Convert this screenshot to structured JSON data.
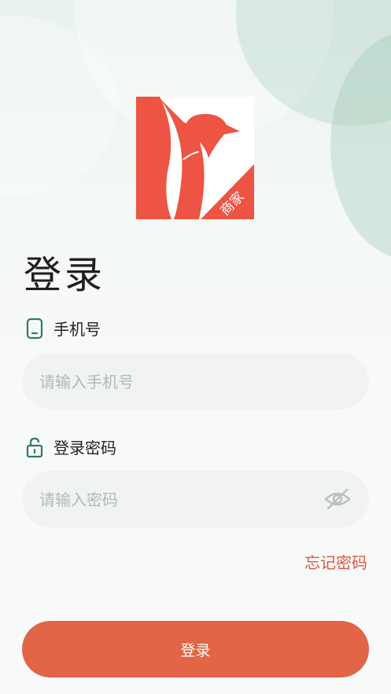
{
  "logo": {
    "badge": "商家",
    "brand_color": "#ee5443"
  },
  "title": "登录",
  "phone": {
    "label": "手机号",
    "placeholder": "请输入手机号",
    "value": ""
  },
  "password": {
    "label": "登录密码",
    "placeholder": "请输入密码",
    "value": ""
  },
  "forgot_label": "忘记密码",
  "login_label": "登录",
  "icons": {
    "phone": "phone-icon",
    "lock": "lock-icon",
    "eye": "eye-off-icon"
  },
  "colors": {
    "accent": "#e16546",
    "icon_green": "#2e7d5b",
    "link": "#e2553d"
  }
}
